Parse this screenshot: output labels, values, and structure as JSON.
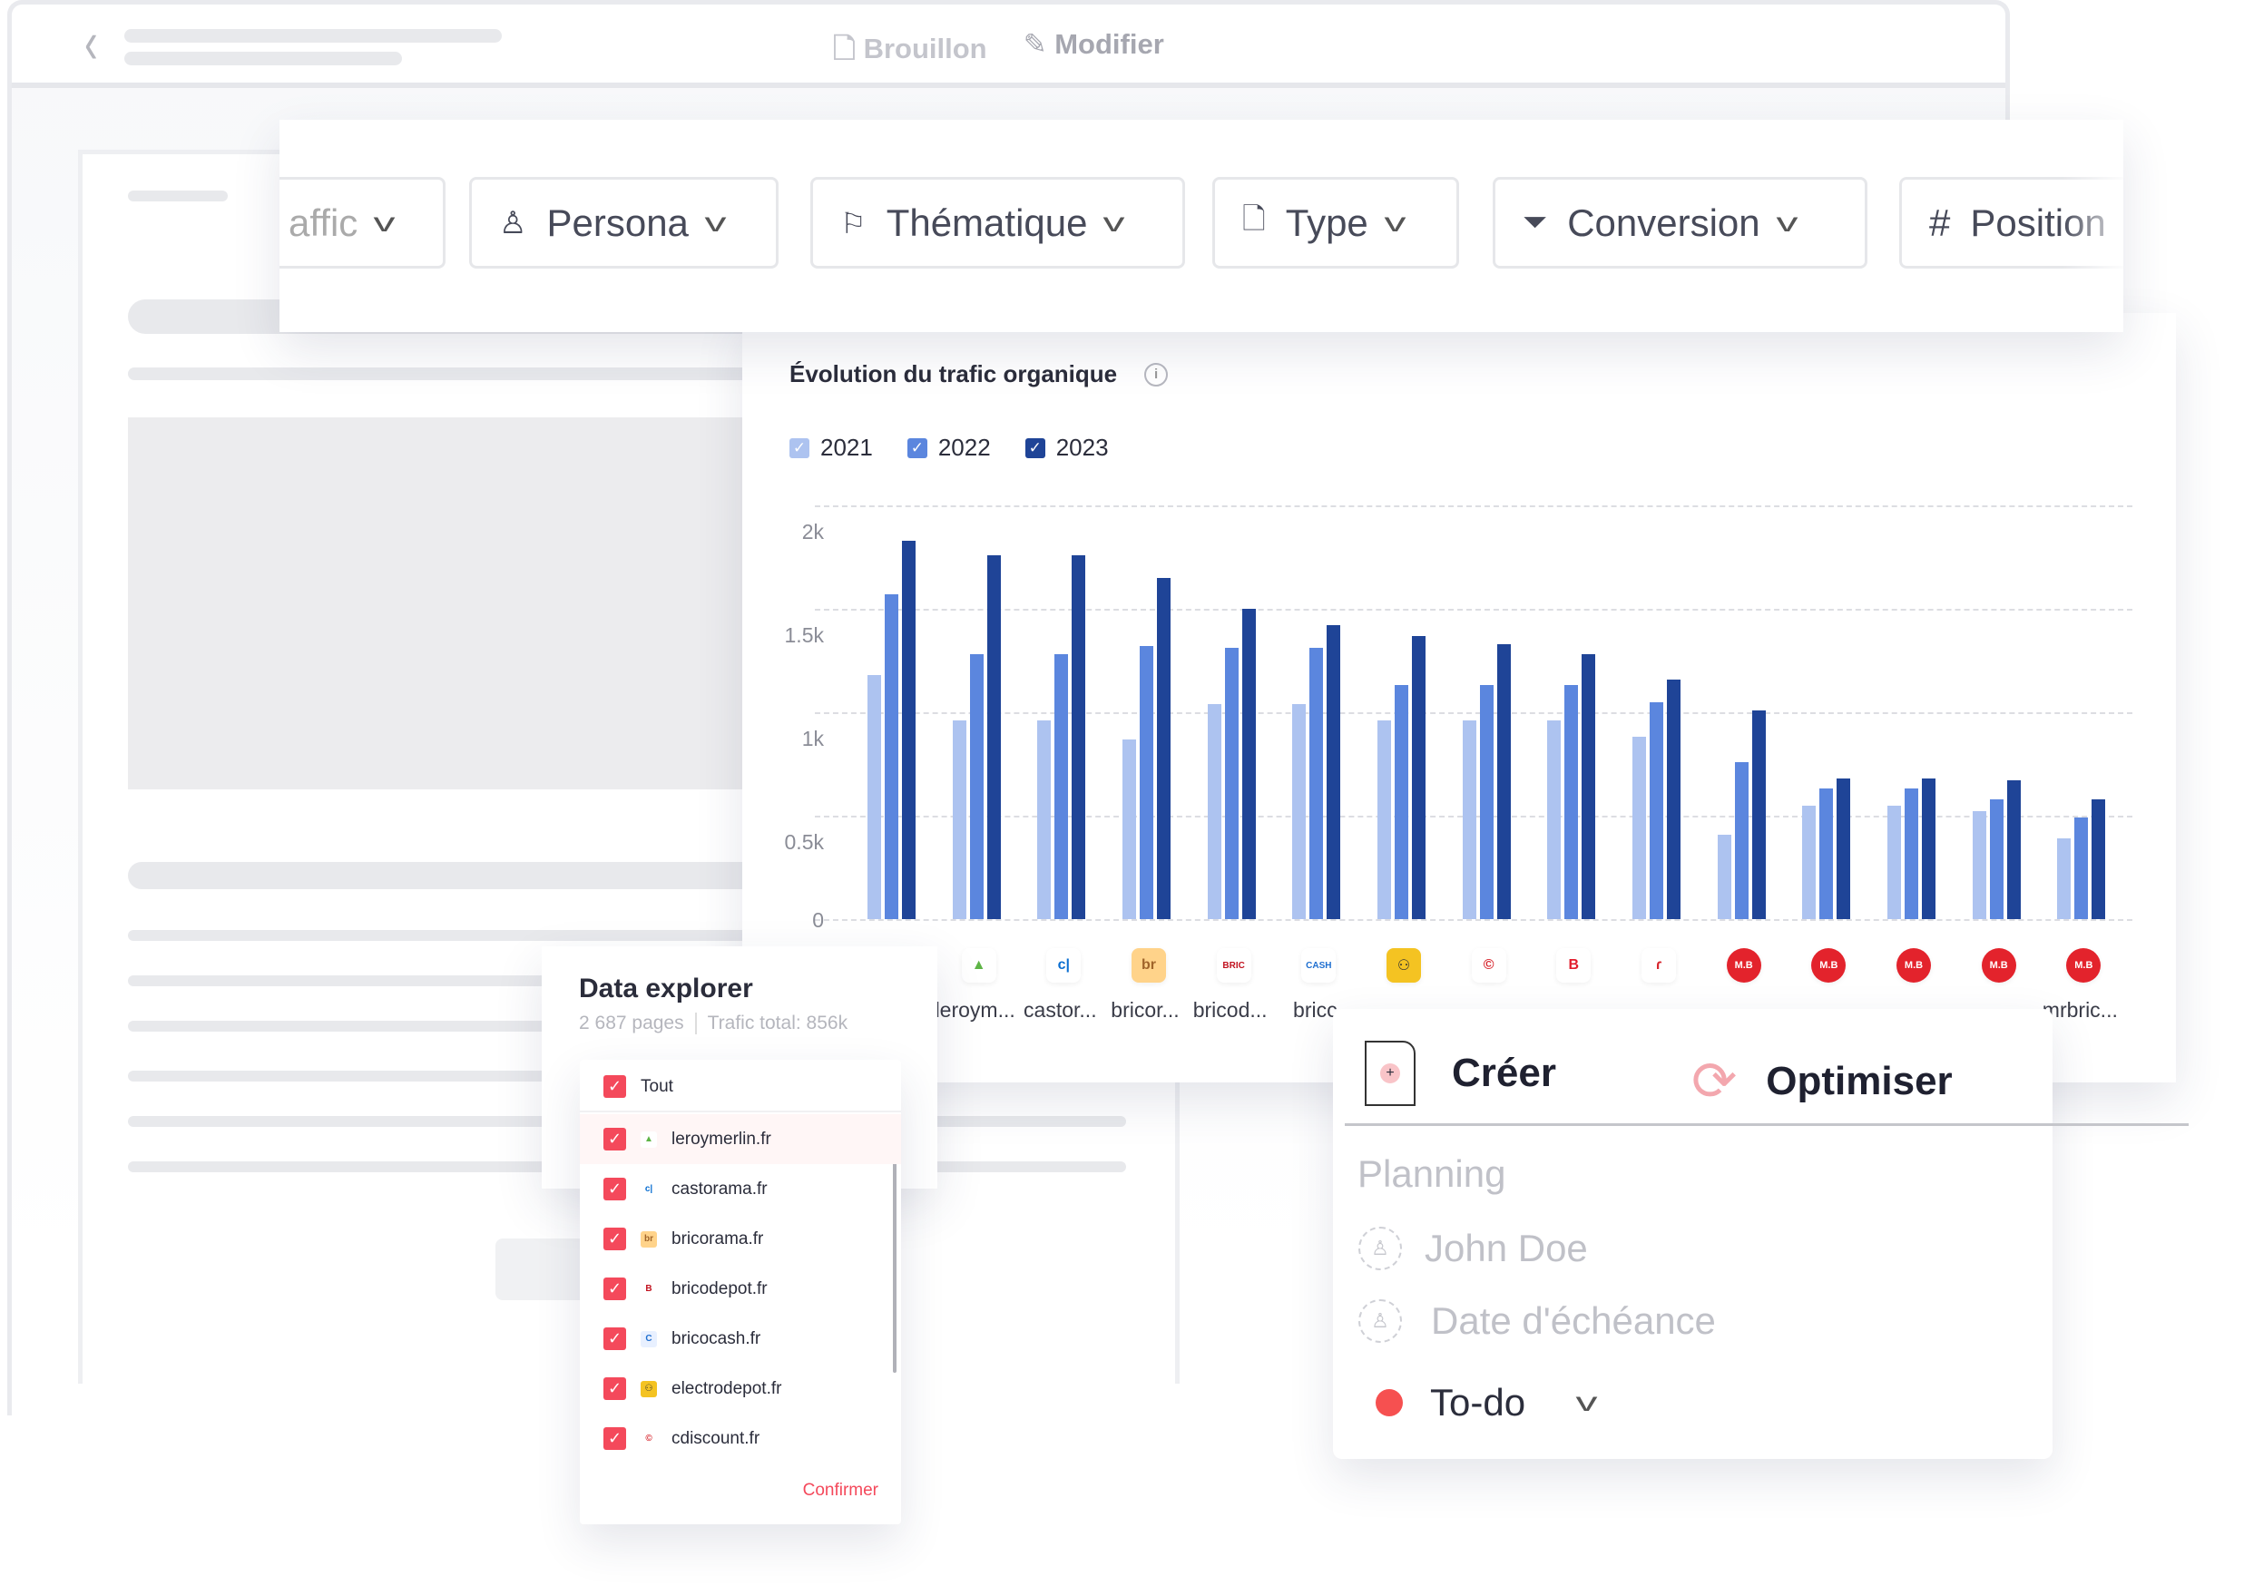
{
  "header": {
    "status_label": "Brouillon",
    "edit_label": "Modifier",
    "status_icon": "document-icon",
    "edit_icon": "pencil-icon"
  },
  "filters": [
    {
      "label": "affic",
      "icon": ""
    },
    {
      "label": "Persona",
      "icon": "user-icon"
    },
    {
      "label": "Thématique",
      "icon": "bookmark-icon"
    },
    {
      "label": "Type",
      "icon": "document-icon"
    },
    {
      "label": "Conversion",
      "icon": "filter-icon"
    },
    {
      "label": "Position",
      "icon": "hash-icon"
    }
  ],
  "chart": {
    "title": "Évolution du trafic organique"
  },
  "chart_data": {
    "type": "bar",
    "title": "Évolution du trafic organique",
    "ylim": [
      0,
      2000
    ],
    "yticks": [
      "0",
      "0.5k",
      "1k",
      "1.5k",
      "2k"
    ],
    "grid": true,
    "legend_placement": "top-left",
    "categories": [
      "",
      "leroym...",
      "castor...",
      "bricor...",
      "bricod...",
      "bricc",
      "",
      "",
      "",
      "",
      "",
      "",
      "",
      "",
      "mrbric..."
    ],
    "series": [
      {
        "name": "2021",
        "color": "#adc3f0",
        "values": [
          1180,
          960,
          960,
          870,
          1040,
          1040,
          960,
          960,
          960,
          880,
          410,
          550,
          550,
          520,
          390
        ]
      },
      {
        "name": "2022",
        "color": "#5b86de",
        "values": [
          1570,
          1280,
          1280,
          1320,
          1310,
          1310,
          1130,
          1130,
          1130,
          1050,
          760,
          630,
          630,
          580,
          490
        ]
      },
      {
        "name": "2023",
        "color": "#1f4497",
        "values": [
          1830,
          1760,
          1760,
          1650,
          1500,
          1420,
          1370,
          1330,
          1280,
          1160,
          1010,
          680,
          680,
          670,
          580
        ]
      }
    ],
    "category_logos": [
      "",
      "leroymerlin",
      "castorama",
      "bricorama",
      "bricodepot",
      "bricocash",
      "electrodepot",
      "cdiscount",
      "bricoman",
      "bricomarche",
      "mrbricolage",
      "mrbricolage",
      "mrbricolage",
      "mrbricolage",
      "mrbricolage"
    ]
  },
  "data_explorer": {
    "title": "Data explorer",
    "pages": "2 687 pages",
    "traffic": "Trafic total: 856k",
    "all_label": "Tout",
    "items": [
      "leroymerlin.fr",
      "castorama.fr",
      "bricorama.fr",
      "bricodepot.fr",
      "bricocash.fr",
      "electrodepot.fr",
      "cdiscount.fr"
    ],
    "confirm_label": "Confirmer",
    "accent": "#f4495b"
  },
  "actions": {
    "create_label": "Créer",
    "optimize_label": "Optimiser",
    "planning_label": "Planning",
    "assignee": "John Doe",
    "due_date": "Date d'échéance",
    "status": "To-do",
    "status_color": "#f65050"
  }
}
